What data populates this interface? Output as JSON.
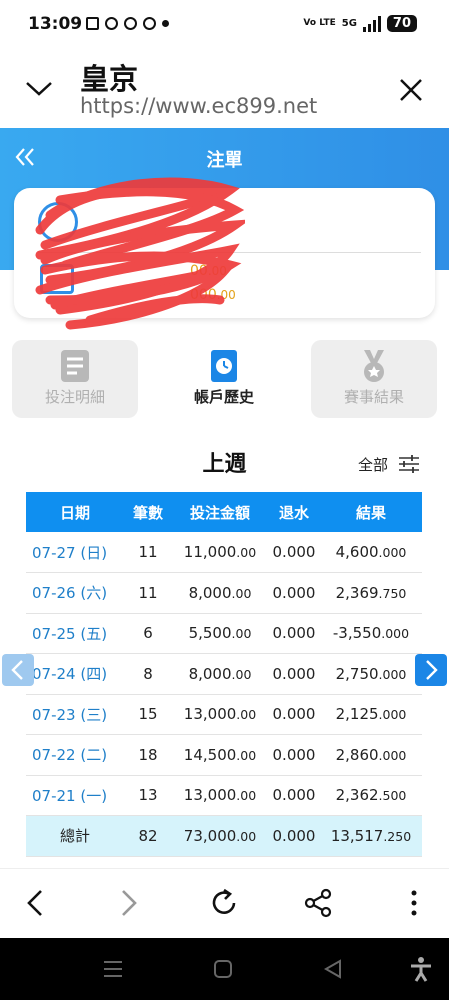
{
  "status": {
    "time": "13:09",
    "network": "5G",
    "volte": "Vo LTE",
    "battery": "70"
  },
  "browser": {
    "site_name": "皇京",
    "url": "https://www.ec899.net"
  },
  "header": {
    "title": "注單"
  },
  "balance_card": {
    "value1": "00",
    "value1_dec": ".00",
    "value2": "000",
    "value2_dec": ".00"
  },
  "tabs": [
    {
      "label": "投注明細",
      "active": false
    },
    {
      "label": "帳戶歷史",
      "active": true
    },
    {
      "label": "賽事結果",
      "active": false
    }
  ],
  "period": {
    "title": "上週",
    "filter_label": "全部"
  },
  "table": {
    "headers": [
      "日期",
      "筆數",
      "投注金額",
      "退水",
      "結果"
    ],
    "rows": [
      {
        "date": "07-27 (日)",
        "count": "11",
        "amount": "11,000",
        "amount_dec": ".00",
        "rebate": "0.000",
        "result": "4,600",
        "result_dec": ".000",
        "sign": "win"
      },
      {
        "date": "07-26 (六)",
        "count": "11",
        "amount": "8,000",
        "amount_dec": ".00",
        "rebate": "0.000",
        "result": "2,369",
        "result_dec": ".750",
        "sign": "win"
      },
      {
        "date": "07-25 (五)",
        "count": "6",
        "amount": "5,500",
        "amount_dec": ".00",
        "rebate": "0.000",
        "result": "-3,550",
        "result_dec": ".000",
        "sign": "loss"
      },
      {
        "date": "07-24 (四)",
        "count": "8",
        "amount": "8,000",
        "amount_dec": ".00",
        "rebate": "0.000",
        "result": "2,750",
        "result_dec": ".000",
        "sign": "win"
      },
      {
        "date": "07-23 (三)",
        "count": "15",
        "amount": "13,000",
        "amount_dec": ".00",
        "rebate": "0.000",
        "result": "2,125",
        "result_dec": ".000",
        "sign": "win"
      },
      {
        "date": "07-22 (二)",
        "count": "18",
        "amount": "14,500",
        "amount_dec": ".00",
        "rebate": "0.000",
        "result": "2,860",
        "result_dec": ".000",
        "sign": "win"
      },
      {
        "date": "07-21 (一)",
        "count": "13",
        "amount": "13,000",
        "amount_dec": ".00",
        "rebate": "0.000",
        "result": "2,362",
        "result_dec": ".500",
        "sign": "win"
      }
    ],
    "total": {
      "label": "總計",
      "count": "82",
      "amount": "73,000",
      "amount_dec": ".00",
      "rebate": "0.000",
      "result": "13,517",
      "result_dec": ".250"
    }
  },
  "colors": {
    "accent": "#0f8ff0",
    "win": "#2a8a2a",
    "loss": "#d63030",
    "gold": "#e3a21a"
  }
}
